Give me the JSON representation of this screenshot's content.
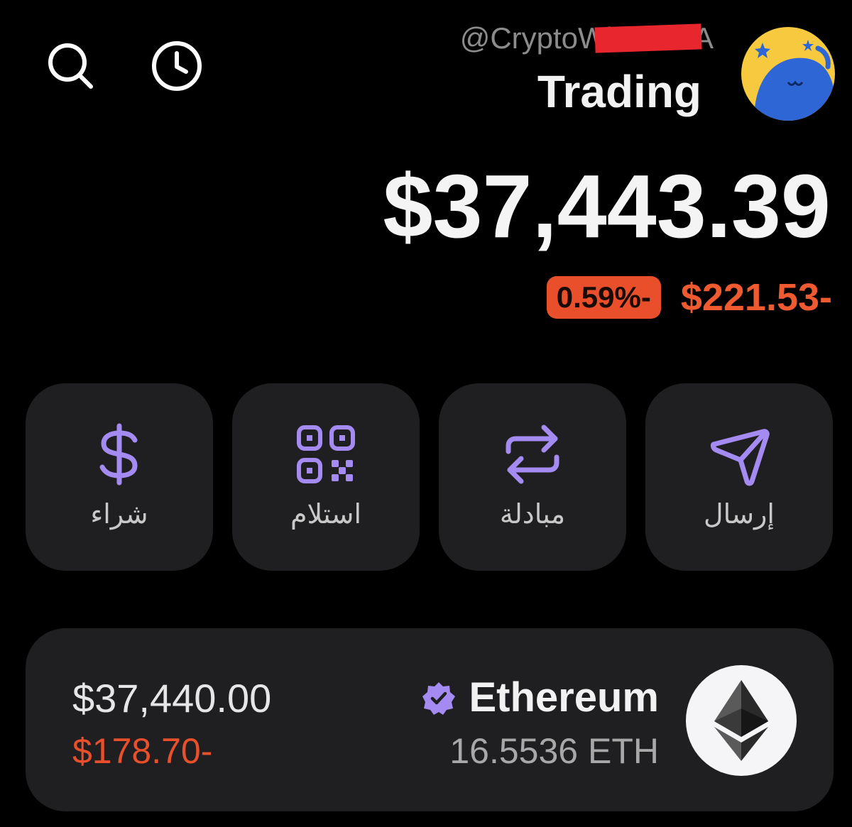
{
  "header": {
    "handle": "@CryptoWhal        A",
    "account_name": "Trading"
  },
  "balance": {
    "total": "$37,443.39",
    "change_percent": "0.59%-",
    "change_amount": "$221.53-"
  },
  "actions": [
    {
      "label": "شراء",
      "icon": "dollar-icon"
    },
    {
      "label": "استلام",
      "icon": "qr-code-icon"
    },
    {
      "label": "مبادلة",
      "icon": "swap-arrows-icon"
    },
    {
      "label": "إرسال",
      "icon": "send-icon"
    }
  ],
  "asset": {
    "name": "Ethereum",
    "amount": "16.5536 ETH",
    "value": "$37,440.00",
    "change": "$178.70-",
    "icon": "ethereum-icon",
    "verified_icon": "verified-badge-icon"
  },
  "colors": {
    "background": "#000000",
    "card": "#1f1f21",
    "accent": "#a48bf2",
    "negative": "#e84f2a"
  }
}
